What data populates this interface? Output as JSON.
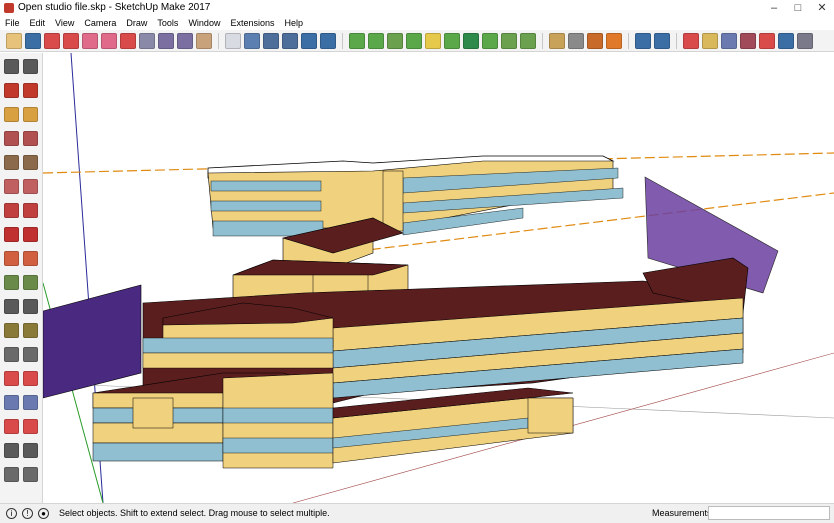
{
  "window": {
    "title": "Open studio file.skp - SketchUp Make 2017"
  },
  "menu": [
    "File",
    "Edit",
    "View",
    "Camera",
    "Draw",
    "Tools",
    "Window",
    "Extensions",
    "Help"
  ],
  "toolbar_icons": [
    {
      "name": "default-tray-icon",
      "color": "#e7c27a"
    },
    {
      "name": "iso-view-icon",
      "color": "#3a6ea5"
    },
    {
      "name": "top-view-icon",
      "color": "#d94a4a"
    },
    {
      "name": "front-view-icon",
      "color": "#d94a4a"
    },
    {
      "name": "right-view-icon",
      "color": "#e06a8a"
    },
    {
      "name": "back-view-icon",
      "color": "#e06a8a"
    },
    {
      "name": "left-view-icon",
      "color": "#d94a4a"
    },
    {
      "name": "xray-icon",
      "color": "#8a8aa8"
    },
    {
      "name": "wireframe-icon",
      "color": "#7a6fa0"
    },
    {
      "name": "hidden-line-icon",
      "color": "#7a6fa0"
    },
    {
      "name": "shaded-icon",
      "color": "#c8a27a"
    },
    {
      "name": "sep"
    },
    {
      "name": "new-model-icon",
      "color": "#d8dbe2"
    },
    {
      "name": "import-icon",
      "color": "#5b7fb0"
    },
    {
      "name": "save-icon",
      "color": "#4d6e9a"
    },
    {
      "name": "open-icon",
      "color": "#4d6e9a"
    },
    {
      "name": "idf-icon",
      "color": "#3a6ea5"
    },
    {
      "name": "export-icon",
      "color": "#3a6ea5"
    },
    {
      "name": "sep"
    },
    {
      "name": "add-space-icon",
      "color": "#5aa84a"
    },
    {
      "name": "add-zone-icon",
      "color": "#5aa84a"
    },
    {
      "name": "add-surface-icon",
      "color": "#6aa04e"
    },
    {
      "name": "add-group-icon",
      "color": "#5aa84a"
    },
    {
      "name": "light-icon",
      "color": "#e6c94a"
    },
    {
      "name": "color-icon",
      "color": "#5aa84a"
    },
    {
      "name": "run-icon",
      "color": "#2d8a4a"
    },
    {
      "name": "match-icon",
      "color": "#5aa84a"
    },
    {
      "name": "surface-match-icon",
      "color": "#6aa04e"
    },
    {
      "name": "grid-icon",
      "color": "#6aa04e"
    },
    {
      "name": "sep"
    },
    {
      "name": "search-icon",
      "color": "#c9a25a"
    },
    {
      "name": "inspect-icon",
      "color": "#8a8a8a"
    },
    {
      "name": "flag-icon",
      "color": "#c86a2a"
    },
    {
      "name": "warning-icon",
      "color": "#e07a2a"
    },
    {
      "name": "sep"
    },
    {
      "name": "info-icon",
      "color": "#3a6ea5"
    },
    {
      "name": "help-icon",
      "color": "#3a6ea5"
    },
    {
      "name": "sep"
    },
    {
      "name": "orbit-icon",
      "color": "#d94a4a"
    },
    {
      "name": "pan-icon",
      "color": "#d8b85a"
    },
    {
      "name": "zoom-icon",
      "color": "#6a7ab0"
    },
    {
      "name": "zoom-window-icon",
      "color": "#a04a5a"
    },
    {
      "name": "zoom-extents-icon",
      "color": "#d94a4a"
    },
    {
      "name": "prev-view-icon",
      "color": "#3a6ea5"
    },
    {
      "name": "next-view-icon",
      "color": "#7a7a8a"
    }
  ],
  "left_tools": [
    [
      "select-arrow-icon",
      "eraser-icon"
    ],
    [
      "paint-bucket-icon",
      "eraser2-icon"
    ],
    [
      "line-icon",
      "freehand-icon"
    ],
    [
      "rectangle-icon",
      "rotated-rect-icon"
    ],
    [
      "circle-icon",
      "polygon-icon"
    ],
    [
      "arc-icon",
      "arc2-icon"
    ],
    [
      "arc3-icon",
      "pie-icon"
    ],
    [
      "move-icon",
      "push-pull-icon"
    ],
    [
      "rotate-icon",
      "follow-me-icon"
    ],
    [
      "scale-icon",
      "offset-icon"
    ],
    [
      "tape-measure-icon",
      "dimension-icon"
    ],
    [
      "protractor-icon",
      "text-icon"
    ],
    [
      "axes-icon",
      "3d-text-icon"
    ],
    [
      "orbit-tool-icon",
      "pan-tool-icon"
    ],
    [
      "zoom-tool-icon",
      "zoom-window-tool-icon"
    ],
    [
      "zoom-extents-tool-icon",
      "previous-tool-icon"
    ],
    [
      "position-camera-icon",
      "look-around-icon"
    ],
    [
      "walk-icon",
      "section-plane-icon"
    ]
  ],
  "left_tool_colors": [
    "#5a5a5a",
    "#c0392b",
    "#d8a040",
    "#b05050",
    "#8a6a4a",
    "#c06060",
    "#c04040",
    "#c03030",
    "#d06040",
    "#6a8a4a",
    "#5a5a5a",
    "#8a7a3a",
    "#6a6a6a",
    "#d94a4a",
    "#6a7ab0",
    "#d94a4a",
    "#5a5a5a",
    "#6a6a6a"
  ],
  "status": {
    "message": "Select objects. Shift to extend select. Drag mouse to select multiple.",
    "measurements_label": "Measurements"
  },
  "colors": {
    "roof": "#5a1e1e",
    "wall": "#f0d17e",
    "glass": "#8fbfd0",
    "shade": "#5a2a82",
    "axis_orange": "#e08a10"
  }
}
